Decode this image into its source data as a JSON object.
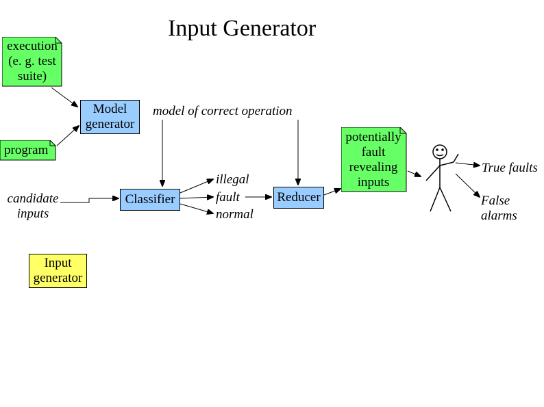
{
  "title": "Input Generator",
  "boxes": {
    "execution1": "execution",
    "execution2": "(e. g. test",
    "execution3": "suite)",
    "program": "program",
    "modelgen1": "Model",
    "modelgen2": "generator",
    "classifier": "Classifier",
    "reducer": "Reducer",
    "potential1": "potentially",
    "potential2": "fault",
    "potential3": "revealing",
    "potential4": "inputs",
    "inputgen1": "Input",
    "inputgen2": "generator"
  },
  "labels": {
    "candidate1": "candidate",
    "candidate2": "inputs",
    "modelcorrect": "model of correct operation",
    "illegal": "illegal",
    "fault": "fault",
    "normal": "normal",
    "truefaults": "True faults",
    "falsealarms": "False alarms"
  }
}
